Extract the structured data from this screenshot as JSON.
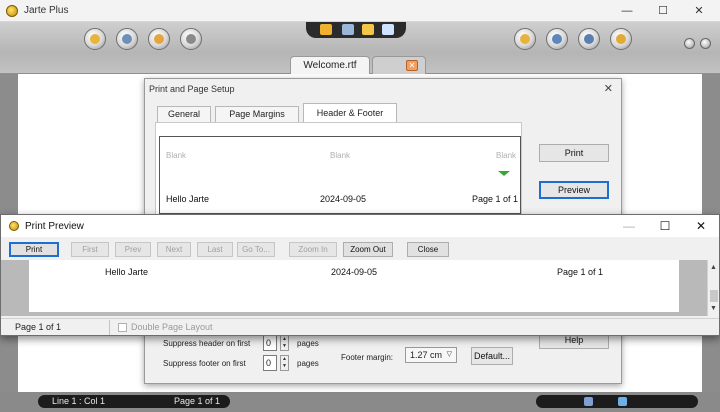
{
  "app": {
    "title": "Jarte Plus"
  },
  "window_controls": {
    "minimize": "—",
    "maximize": "☐",
    "close": "✕"
  },
  "document_tab": {
    "label": "Welcome.rtf"
  },
  "setup_dialog": {
    "title": "Print and Page Setup",
    "close": "✕",
    "tabs": [
      "General",
      "Page Margins",
      "Header & Footer"
    ],
    "active_tab": "Header & Footer",
    "header_placeholders": [
      "Blank",
      "Blank",
      "Blank"
    ],
    "footer_values": [
      "Hello Jarte",
      "2024-09-05",
      "Page 1 of 1"
    ],
    "buttons": {
      "print": "Print",
      "preview": "Preview",
      "help": "Help",
      "default": "Default..."
    },
    "suppress_header_label": "Suppress header on first",
    "suppress_header_value": "0",
    "suppress_footer_label": "Suppress footer on first",
    "suppress_footer_value": "0",
    "pages_label": "pages",
    "footer_margin_label": "Footer margin:",
    "footer_margin_value": "1.27 cm"
  },
  "preview_window": {
    "title": "Print Preview",
    "controls": {
      "minimize": "—",
      "maximize": "☐",
      "close": "✕"
    },
    "toolbar": [
      {
        "label": "Print",
        "enabled": true
      },
      {
        "label": "First",
        "enabled": false
      },
      {
        "label": "Prev",
        "enabled": false
      },
      {
        "label": "Next",
        "enabled": false
      },
      {
        "label": "Last",
        "enabled": false
      },
      {
        "label": "Go To...",
        "enabled": false
      },
      {
        "label": "Zoom In",
        "enabled": false
      },
      {
        "label": "Zoom Out",
        "enabled": true
      },
      {
        "label": "Close",
        "enabled": true
      }
    ],
    "page_footer": [
      "Hello Jarte",
      "2024-09-05",
      "Page 1 of 1"
    ],
    "status_page": "Page 1 of 1",
    "double_page_label": "Double Page Layout"
  },
  "statusbar": {
    "position": "Line 1 : Col 1",
    "page": "Page 1 of 1"
  },
  "icons": [
    "jarte-logo-icon",
    "open-icon",
    "clock-icon",
    "hand-icon",
    "settings-icon",
    "help-icon",
    "info-icon",
    "share-icon",
    "print-icon",
    "find-icon"
  ]
}
